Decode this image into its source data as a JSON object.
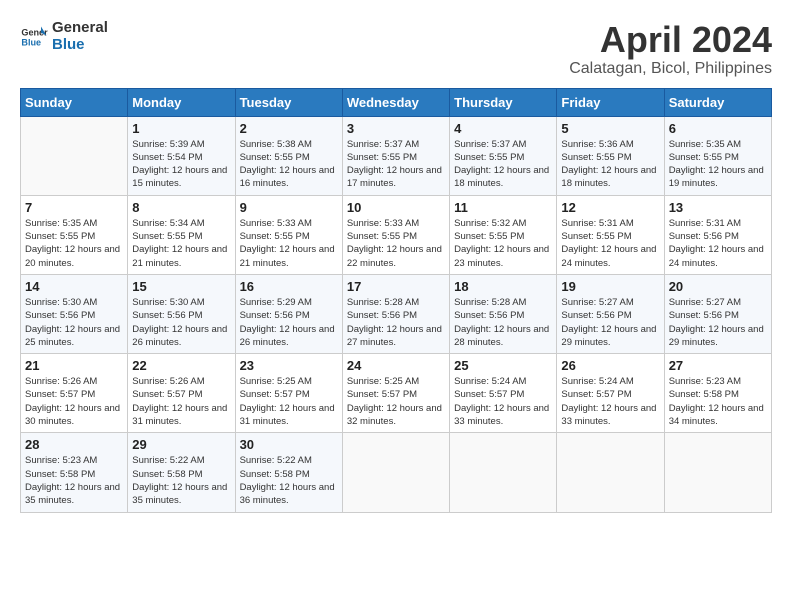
{
  "header": {
    "logo_line1": "General",
    "logo_line2": "Blue",
    "month": "April 2024",
    "location": "Calatagan, Bicol, Philippines"
  },
  "weekdays": [
    "Sunday",
    "Monday",
    "Tuesday",
    "Wednesday",
    "Thursday",
    "Friday",
    "Saturday"
  ],
  "weeks": [
    [
      {
        "day": "",
        "sunrise": "",
        "sunset": "",
        "daylight": ""
      },
      {
        "day": "1",
        "sunrise": "Sunrise: 5:39 AM",
        "sunset": "Sunset: 5:54 PM",
        "daylight": "Daylight: 12 hours and 15 minutes."
      },
      {
        "day": "2",
        "sunrise": "Sunrise: 5:38 AM",
        "sunset": "Sunset: 5:55 PM",
        "daylight": "Daylight: 12 hours and 16 minutes."
      },
      {
        "day": "3",
        "sunrise": "Sunrise: 5:37 AM",
        "sunset": "Sunset: 5:55 PM",
        "daylight": "Daylight: 12 hours and 17 minutes."
      },
      {
        "day": "4",
        "sunrise": "Sunrise: 5:37 AM",
        "sunset": "Sunset: 5:55 PM",
        "daylight": "Daylight: 12 hours and 18 minutes."
      },
      {
        "day": "5",
        "sunrise": "Sunrise: 5:36 AM",
        "sunset": "Sunset: 5:55 PM",
        "daylight": "Daylight: 12 hours and 18 minutes."
      },
      {
        "day": "6",
        "sunrise": "Sunrise: 5:35 AM",
        "sunset": "Sunset: 5:55 PM",
        "daylight": "Daylight: 12 hours and 19 minutes."
      }
    ],
    [
      {
        "day": "7",
        "sunrise": "Sunrise: 5:35 AM",
        "sunset": "Sunset: 5:55 PM",
        "daylight": "Daylight: 12 hours and 20 minutes."
      },
      {
        "day": "8",
        "sunrise": "Sunrise: 5:34 AM",
        "sunset": "Sunset: 5:55 PM",
        "daylight": "Daylight: 12 hours and 21 minutes."
      },
      {
        "day": "9",
        "sunrise": "Sunrise: 5:33 AM",
        "sunset": "Sunset: 5:55 PM",
        "daylight": "Daylight: 12 hours and 21 minutes."
      },
      {
        "day": "10",
        "sunrise": "Sunrise: 5:33 AM",
        "sunset": "Sunset: 5:55 PM",
        "daylight": "Daylight: 12 hours and 22 minutes."
      },
      {
        "day": "11",
        "sunrise": "Sunrise: 5:32 AM",
        "sunset": "Sunset: 5:55 PM",
        "daylight": "Daylight: 12 hours and 23 minutes."
      },
      {
        "day": "12",
        "sunrise": "Sunrise: 5:31 AM",
        "sunset": "Sunset: 5:55 PM",
        "daylight": "Daylight: 12 hours and 24 minutes."
      },
      {
        "day": "13",
        "sunrise": "Sunrise: 5:31 AM",
        "sunset": "Sunset: 5:56 PM",
        "daylight": "Daylight: 12 hours and 24 minutes."
      }
    ],
    [
      {
        "day": "14",
        "sunrise": "Sunrise: 5:30 AM",
        "sunset": "Sunset: 5:56 PM",
        "daylight": "Daylight: 12 hours and 25 minutes."
      },
      {
        "day": "15",
        "sunrise": "Sunrise: 5:30 AM",
        "sunset": "Sunset: 5:56 PM",
        "daylight": "Daylight: 12 hours and 26 minutes."
      },
      {
        "day": "16",
        "sunrise": "Sunrise: 5:29 AM",
        "sunset": "Sunset: 5:56 PM",
        "daylight": "Daylight: 12 hours and 26 minutes."
      },
      {
        "day": "17",
        "sunrise": "Sunrise: 5:28 AM",
        "sunset": "Sunset: 5:56 PM",
        "daylight": "Daylight: 12 hours and 27 minutes."
      },
      {
        "day": "18",
        "sunrise": "Sunrise: 5:28 AM",
        "sunset": "Sunset: 5:56 PM",
        "daylight": "Daylight: 12 hours and 28 minutes."
      },
      {
        "day": "19",
        "sunrise": "Sunrise: 5:27 AM",
        "sunset": "Sunset: 5:56 PM",
        "daylight": "Daylight: 12 hours and 29 minutes."
      },
      {
        "day": "20",
        "sunrise": "Sunrise: 5:27 AM",
        "sunset": "Sunset: 5:56 PM",
        "daylight": "Daylight: 12 hours and 29 minutes."
      }
    ],
    [
      {
        "day": "21",
        "sunrise": "Sunrise: 5:26 AM",
        "sunset": "Sunset: 5:57 PM",
        "daylight": "Daylight: 12 hours and 30 minutes."
      },
      {
        "day": "22",
        "sunrise": "Sunrise: 5:26 AM",
        "sunset": "Sunset: 5:57 PM",
        "daylight": "Daylight: 12 hours and 31 minutes."
      },
      {
        "day": "23",
        "sunrise": "Sunrise: 5:25 AM",
        "sunset": "Sunset: 5:57 PM",
        "daylight": "Daylight: 12 hours and 31 minutes."
      },
      {
        "day": "24",
        "sunrise": "Sunrise: 5:25 AM",
        "sunset": "Sunset: 5:57 PM",
        "daylight": "Daylight: 12 hours and 32 minutes."
      },
      {
        "day": "25",
        "sunrise": "Sunrise: 5:24 AM",
        "sunset": "Sunset: 5:57 PM",
        "daylight": "Daylight: 12 hours and 33 minutes."
      },
      {
        "day": "26",
        "sunrise": "Sunrise: 5:24 AM",
        "sunset": "Sunset: 5:57 PM",
        "daylight": "Daylight: 12 hours and 33 minutes."
      },
      {
        "day": "27",
        "sunrise": "Sunrise: 5:23 AM",
        "sunset": "Sunset: 5:58 PM",
        "daylight": "Daylight: 12 hours and 34 minutes."
      }
    ],
    [
      {
        "day": "28",
        "sunrise": "Sunrise: 5:23 AM",
        "sunset": "Sunset: 5:58 PM",
        "daylight": "Daylight: 12 hours and 35 minutes."
      },
      {
        "day": "29",
        "sunrise": "Sunrise: 5:22 AM",
        "sunset": "Sunset: 5:58 PM",
        "daylight": "Daylight: 12 hours and 35 minutes."
      },
      {
        "day": "30",
        "sunrise": "Sunrise: 5:22 AM",
        "sunset": "Sunset: 5:58 PM",
        "daylight": "Daylight: 12 hours and 36 minutes."
      },
      {
        "day": "",
        "sunrise": "",
        "sunset": "",
        "daylight": ""
      },
      {
        "day": "",
        "sunrise": "",
        "sunset": "",
        "daylight": ""
      },
      {
        "day": "",
        "sunrise": "",
        "sunset": "",
        "daylight": ""
      },
      {
        "day": "",
        "sunrise": "",
        "sunset": "",
        "daylight": ""
      }
    ]
  ]
}
